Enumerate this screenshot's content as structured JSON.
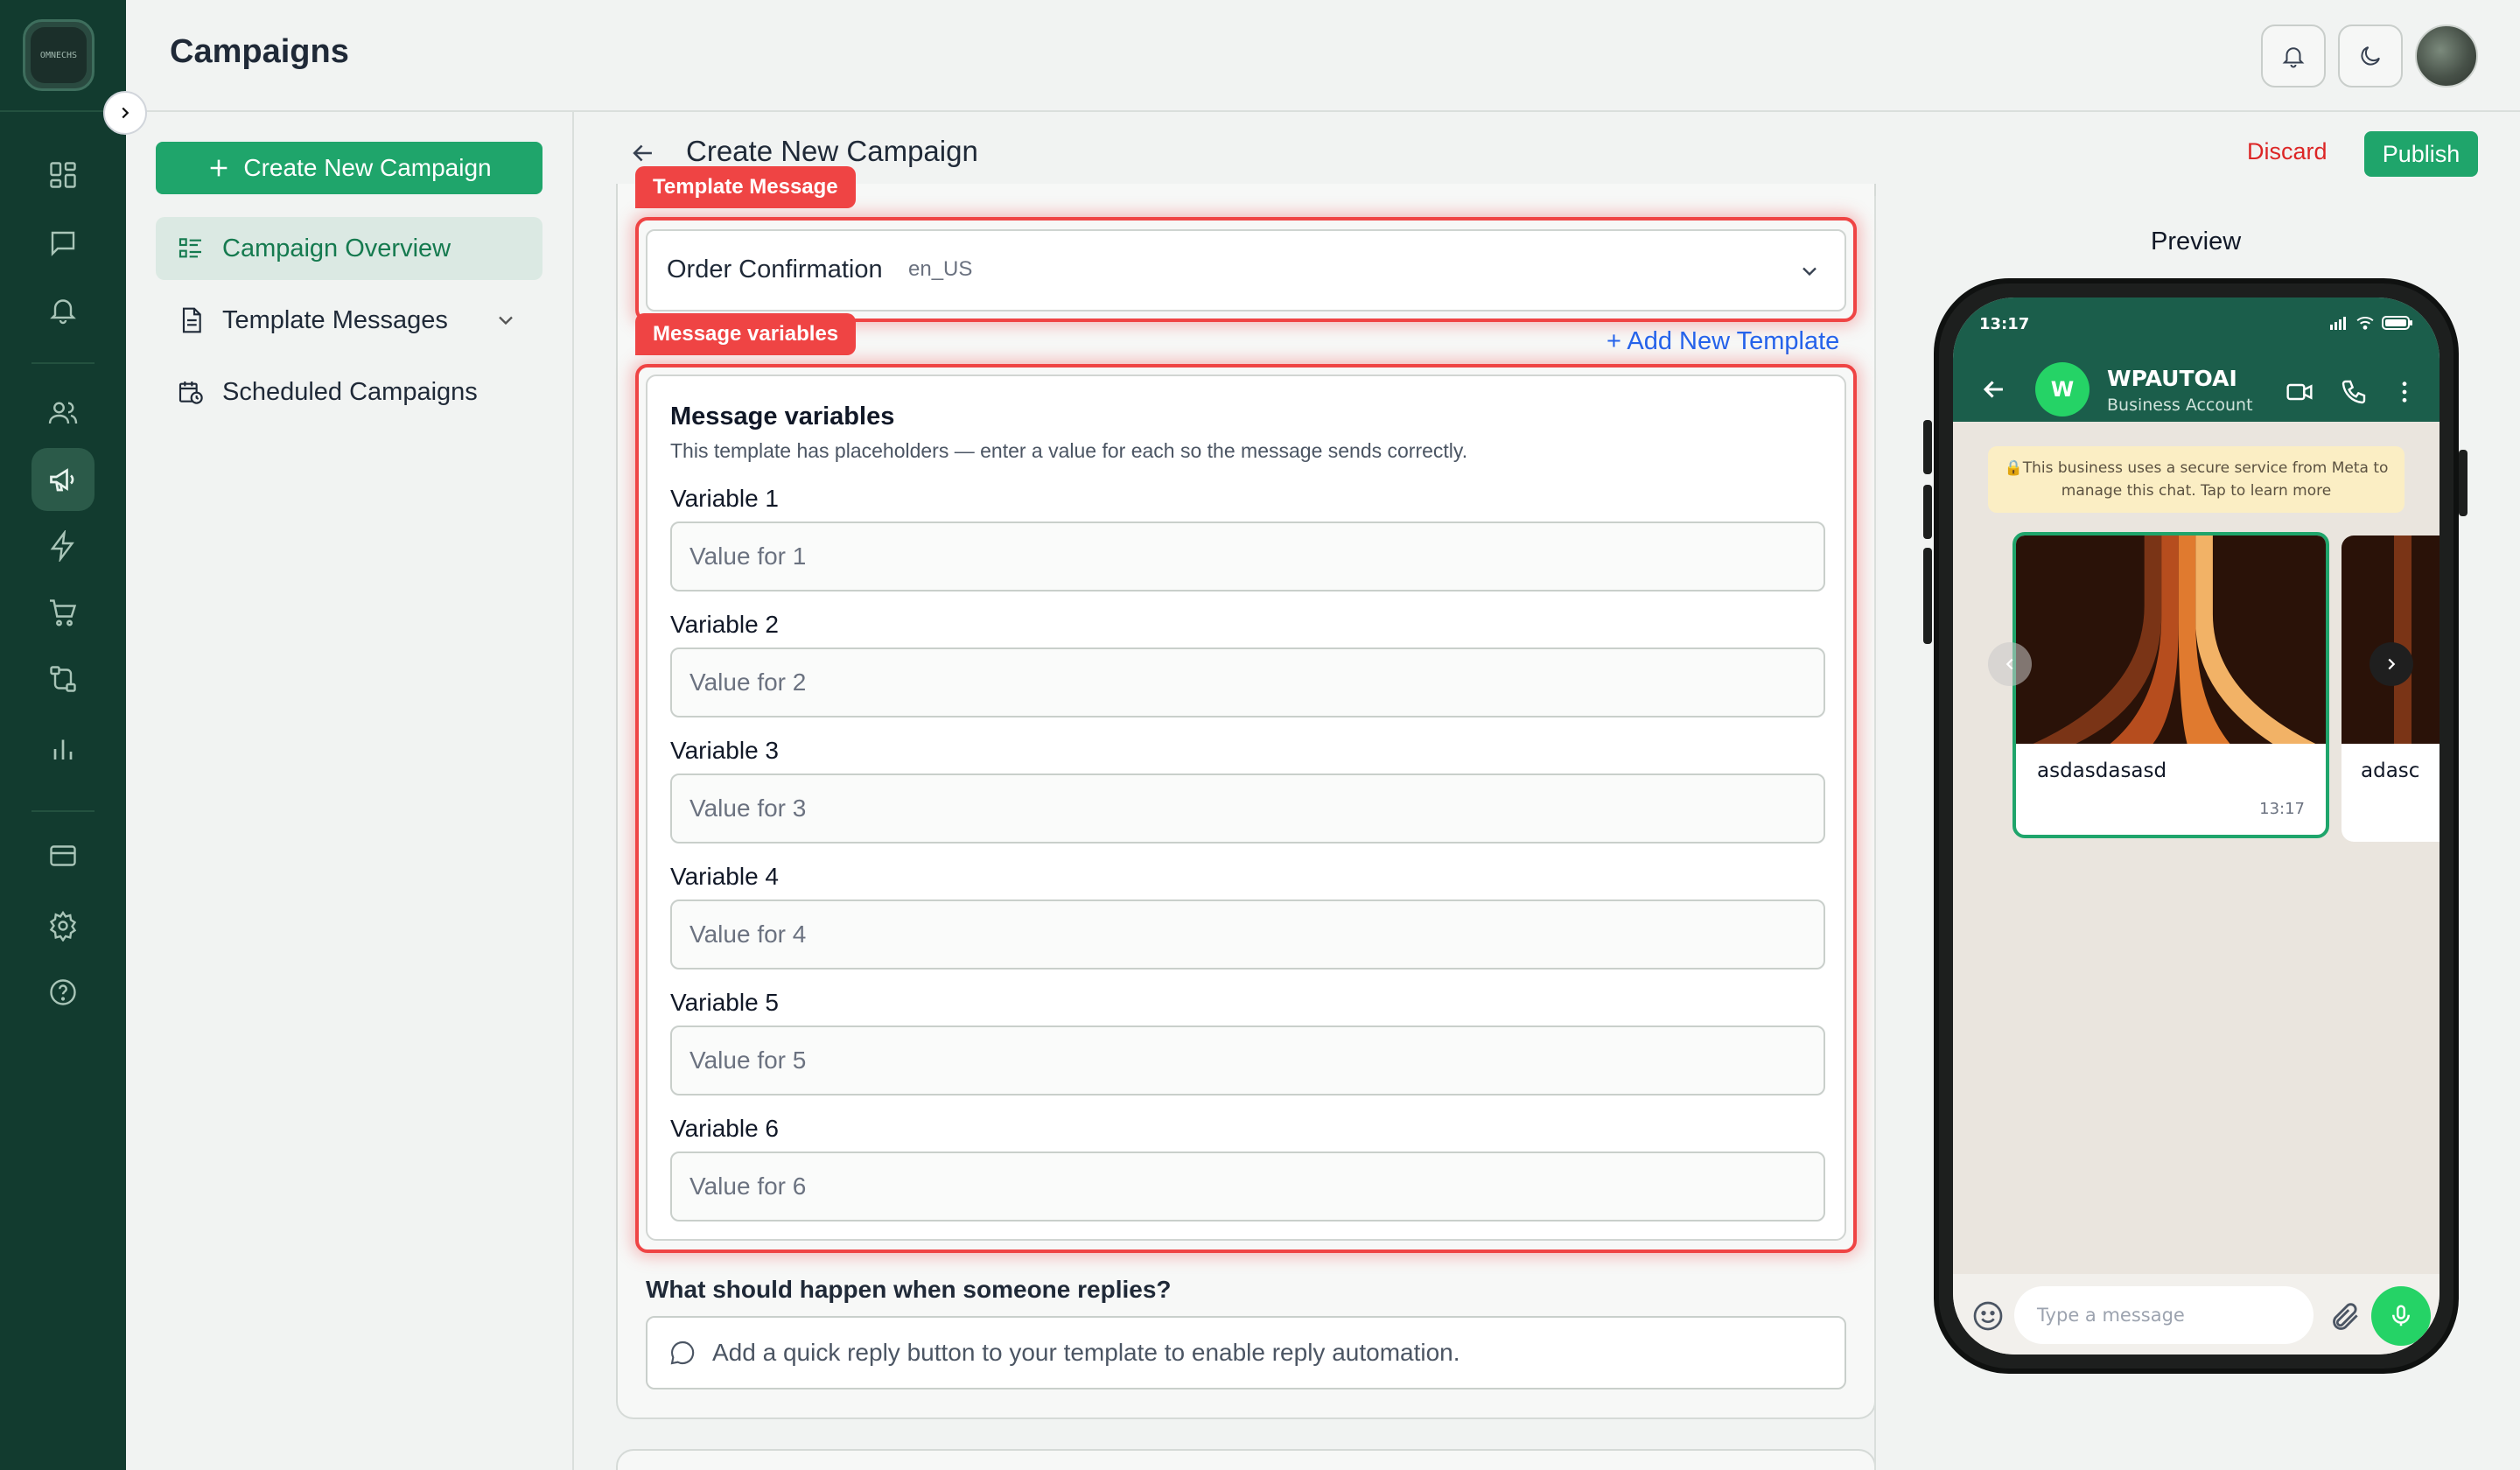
{
  "rail": {
    "logo_text": "OMNECHS",
    "items": [
      {
        "icon": "dashboard-grid-icon"
      },
      {
        "icon": "chat-bubble-icon"
      },
      {
        "icon": "bell-icon"
      },
      {
        "icon": "users-icon"
      },
      {
        "icon": "megaphone-icon",
        "active": true
      },
      {
        "icon": "lightning-icon"
      },
      {
        "icon": "cart-icon"
      },
      {
        "icon": "flow-icon"
      },
      {
        "icon": "bar-chart-icon"
      },
      {
        "icon": "credit-card-icon"
      },
      {
        "icon": "gear-icon"
      },
      {
        "icon": "help-circle-icon"
      }
    ]
  },
  "header": {
    "title": "Campaigns"
  },
  "subnav": {
    "create_label": "Create New Campaign",
    "items": [
      {
        "label": "Campaign Overview",
        "active": true
      },
      {
        "label": "Template Messages"
      },
      {
        "label": "Scheduled Campaigns"
      }
    ]
  },
  "main": {
    "title": "Create New Campaign",
    "discard_label": "Discard",
    "publish_label": "Publish",
    "template_tag": "Template Message",
    "template_select": {
      "value": "Order Confirmation",
      "locale": "en_US"
    },
    "add_template_label": "+ Add New Template",
    "variables_tag": "Message variables",
    "variables_title": "Message variables",
    "variables_subtitle": "This template has placeholders — enter a value for each so the message sends correctly.",
    "variables": [
      {
        "label": "Variable 1",
        "placeholder": "Value for 1"
      },
      {
        "label": "Variable 2",
        "placeholder": "Value for 2"
      },
      {
        "label": "Variable 3",
        "placeholder": "Value for 3"
      },
      {
        "label": "Variable 4",
        "placeholder": "Value for 4"
      },
      {
        "label": "Variable 5",
        "placeholder": "Value for 5"
      },
      {
        "label": "Variable 6",
        "placeholder": "Value for 6"
      }
    ],
    "reply_question": "What should happen when someone replies?",
    "reply_hint": "Add a quick reply button to your template to enable reply automation."
  },
  "preview": {
    "title": "Preview",
    "status_time": "13:17",
    "contact_initial": "W",
    "contact_name": "WPAUTOAI",
    "contact_sub": "Business Account",
    "notice": "This business uses a secure service from Meta to manage this chat. Tap to learn more",
    "cards": [
      {
        "text": "asdasdasasd",
        "time": "13:17"
      },
      {
        "text": "adasc"
      }
    ],
    "input_placeholder": "Type a message"
  },
  "colors": {
    "rail_bg": "#123b2f",
    "accent_green": "#1fa56b",
    "highlight_red": "#ef4444",
    "discard_red": "#dc2626",
    "link_blue": "#2563eb",
    "wa_header": "#1b5e4b"
  }
}
